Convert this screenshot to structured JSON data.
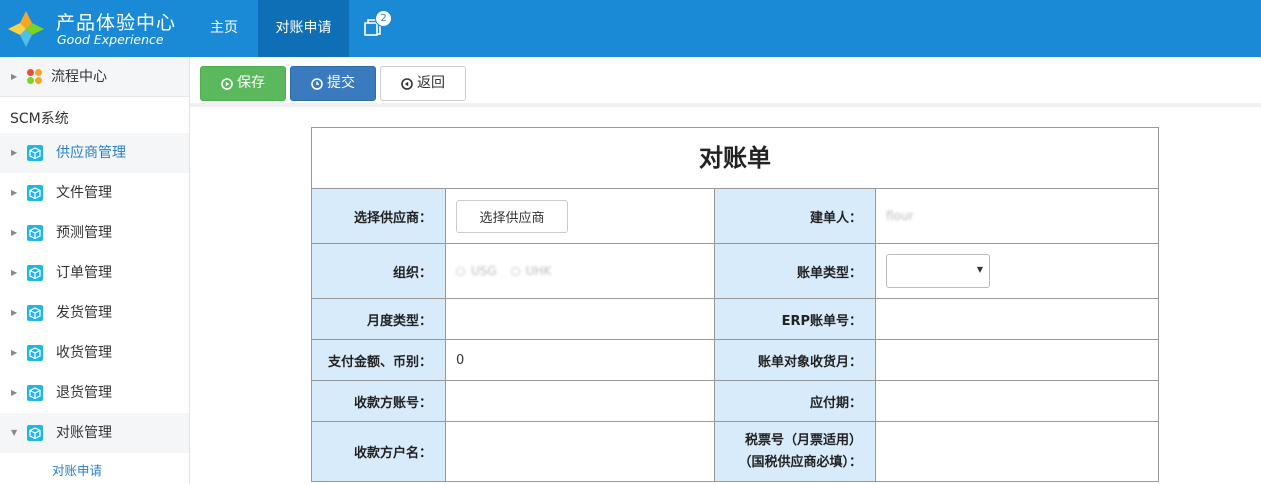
{
  "header": {
    "logo_cn": "产品体验中心",
    "logo_en": "Good Experience",
    "nav": [
      "主页",
      "对账申请"
    ],
    "message_count": "2",
    "brand_color": "#1a8ad6"
  },
  "sidebar": {
    "flow_label": "流程中心",
    "system_label": "SCM系统",
    "items": [
      {
        "label": "供应商管理",
        "icon": "cube-icon"
      },
      {
        "label": "文件管理",
        "icon": "cube-icon"
      },
      {
        "label": "预测管理",
        "icon": "cube-icon"
      },
      {
        "label": "订单管理",
        "icon": "cube-icon"
      },
      {
        "label": "发货管理",
        "icon": "cube-icon"
      },
      {
        "label": "收货管理",
        "icon": "cube-icon"
      },
      {
        "label": "退货管理",
        "icon": "cube-icon"
      },
      {
        "label": "对账管理",
        "icon": "cube-icon"
      }
    ],
    "sub_item": "对账申请"
  },
  "toolbar": {
    "save_label": "保存",
    "submit_label": "提交",
    "back_label": "返回"
  },
  "form": {
    "title": "对账单",
    "supplier_label": "选择供应商：",
    "supplier_button": "选择供应商",
    "creator_label": "建单人：",
    "creator_value": "flour",
    "org_label": "组织：",
    "org_options": [
      "USG",
      "UHK"
    ],
    "bill_type_label": "账单类型：",
    "bill_type_value": "",
    "month_type_label": "月度类型：",
    "month_type_value": "",
    "erp_label": "ERP账单号：",
    "erp_value": "",
    "amount_label": "支付金额、币别：",
    "amount_value": "0",
    "target_month_label": "账单对象收货月：",
    "target_month_value": "",
    "payee_account_label": "收款方账号：",
    "payee_account_value": "",
    "due_label": "应付期：",
    "due_value": "",
    "payee_name_label": "收款方户名：",
    "payee_name_value": "",
    "tax_label_1": "税票号（月票适用）",
    "tax_label_2": "（国税供应商必填）：",
    "tax_value": ""
  }
}
